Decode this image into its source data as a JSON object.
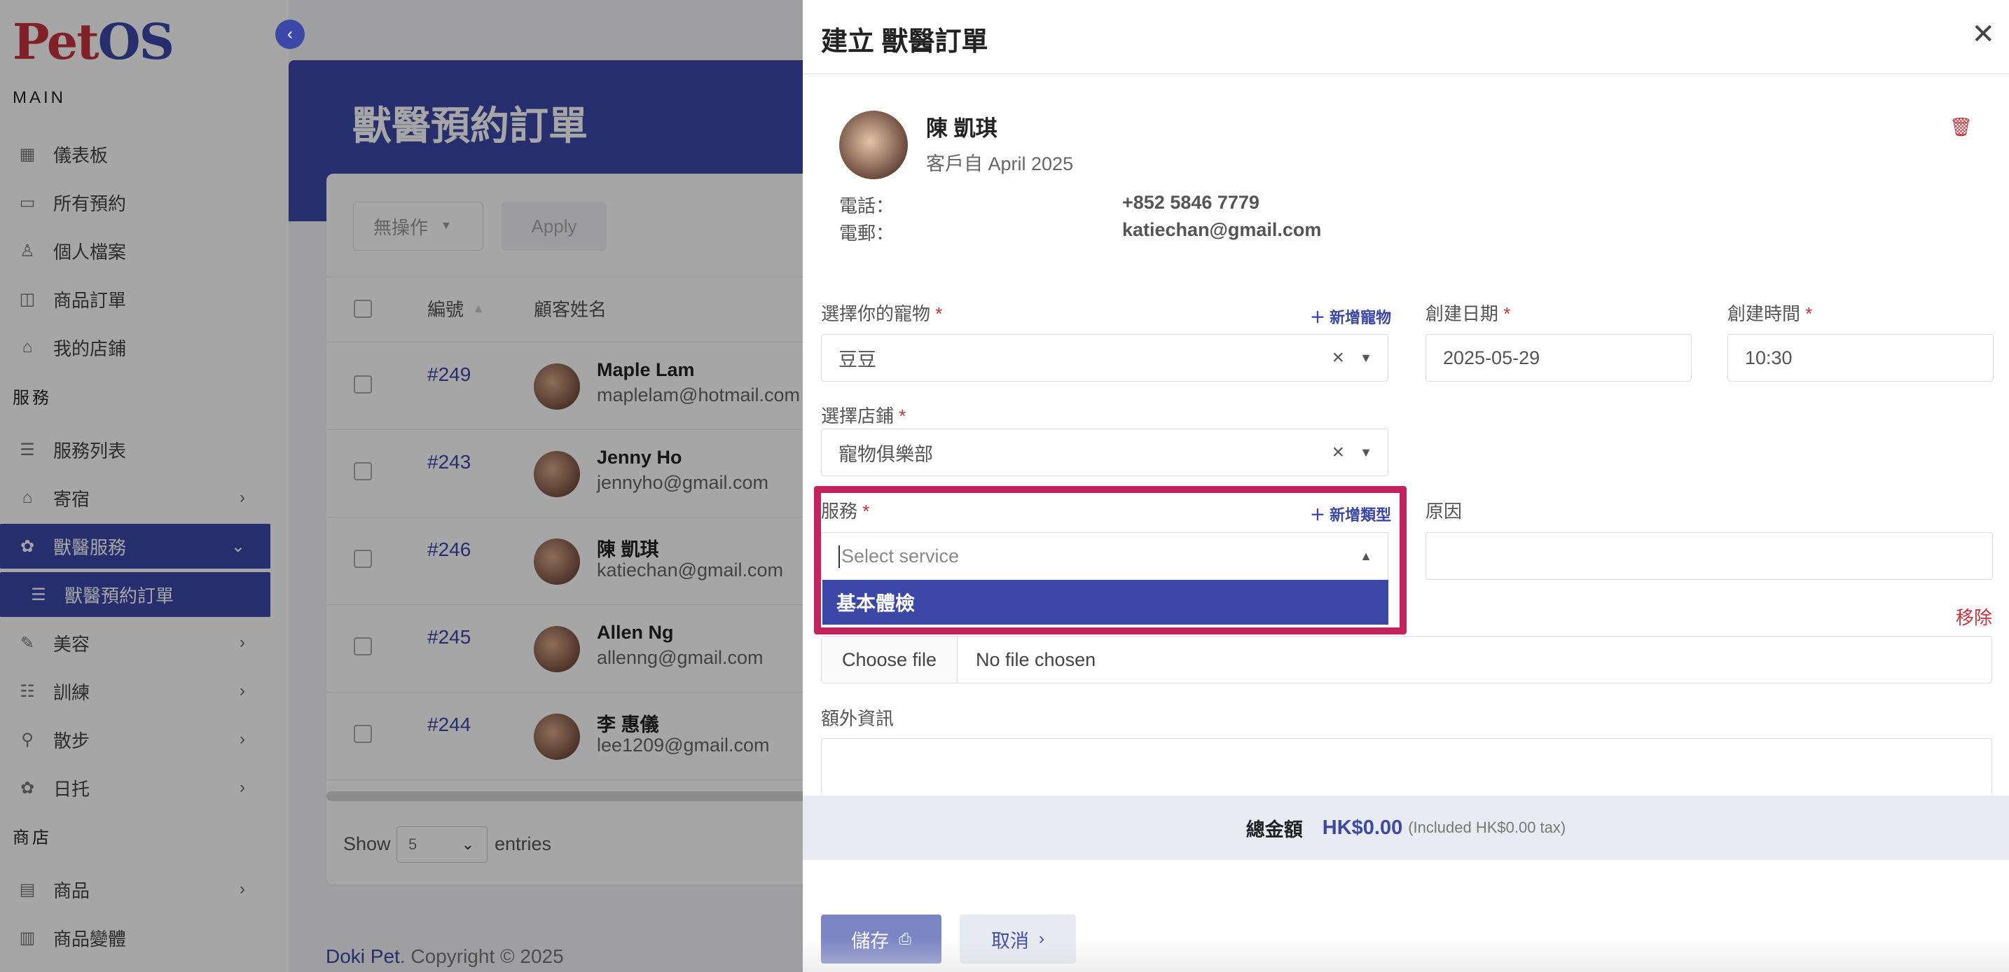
{
  "app": {
    "logo_pet": "Pet",
    "logo_os": "OS"
  },
  "sidebar": {
    "main_title": "MAIN",
    "services_title": "服務",
    "shop_title": "商店",
    "items": [
      {
        "label": "儀表板",
        "icon": "dashboard-icon"
      },
      {
        "label": "所有預約",
        "icon": "calendar-icon"
      },
      {
        "label": "個人檔案",
        "icon": "user-icon"
      },
      {
        "label": "商品訂單",
        "icon": "bag-icon"
      },
      {
        "label": "我的店鋪",
        "icon": "store-icon"
      },
      {
        "label": "服務列表",
        "icon": "list-icon"
      },
      {
        "label": "寄宿",
        "icon": "home-icon"
      },
      {
        "label": "獸醫服務",
        "icon": "vet-icon"
      },
      {
        "label": "獸醫預約訂單",
        "icon": "list-icon"
      },
      {
        "label": "美容",
        "icon": "brush-icon"
      },
      {
        "label": "訓練",
        "icon": "training-icon"
      },
      {
        "label": "散步",
        "icon": "walk-icon"
      },
      {
        "label": "日托",
        "icon": "daycare-icon"
      },
      {
        "label": "商品",
        "icon": "box-icon"
      },
      {
        "label": "商品變體",
        "icon": "variant-icon"
      }
    ]
  },
  "main": {
    "title": "獸醫預約訂單",
    "bulk_action": "無操作",
    "apply": "Apply",
    "columns": {
      "id": "編號",
      "customer": "顧客姓名"
    },
    "rows": [
      {
        "id": "#249",
        "name": "Maple Lam",
        "email": "maplelam@hotmail.com"
      },
      {
        "id": "#243",
        "name": "Jenny Ho",
        "email": "jennyho@gmail.com"
      },
      {
        "id": "#246",
        "name": "陳 凱琪",
        "email": "katiechan@gmail.com"
      },
      {
        "id": "#245",
        "name": "Allen Ng",
        "email": "allenng@gmail.com"
      },
      {
        "id": "#244",
        "name": "李 惠儀",
        "email": "lee1209@gmail.com"
      }
    ],
    "show_label": "Show",
    "show_value": "5",
    "entries_label": "entries",
    "footer_brand": "Doki Pet",
    "footer_text": ". Copyright © 2025"
  },
  "drawer": {
    "title": "建立 獸醫訂單",
    "customer": {
      "name": "陳 凱琪",
      "since": "客戶自 April 2025",
      "phone_label": "電話：",
      "phone": "+852 5846 7779",
      "email_label": "電郵：",
      "email": "katiechan@gmail.com"
    },
    "pet_label": "選擇你的寵物",
    "add_pet": "新增寵物",
    "pet_value": "豆豆",
    "date_label": "創建日期",
    "date_value": "2025-05-29",
    "time_label": "創建時間",
    "time_value": "10:30",
    "store_label": "選擇店鋪",
    "store_value": "寵物俱樂部",
    "service_label": "服務",
    "add_type": "新增類型",
    "service_placeholder": "Select service",
    "service_option": "基本體檢",
    "reason_label": "原因",
    "remove": "移除",
    "choose_file": "Choose file",
    "no_file": "No file chosen",
    "extra_label": "額外資訊",
    "total_label": "總金額",
    "total_value": "HK$0.00",
    "total_tax": "(Included HK$0.00 tax)",
    "save": "儲存",
    "cancel": "取消",
    "required_mark": "*"
  },
  "colors": {
    "primary": "#3c48a8",
    "danger": "#c8323c",
    "highlight": "#c2235c"
  }
}
